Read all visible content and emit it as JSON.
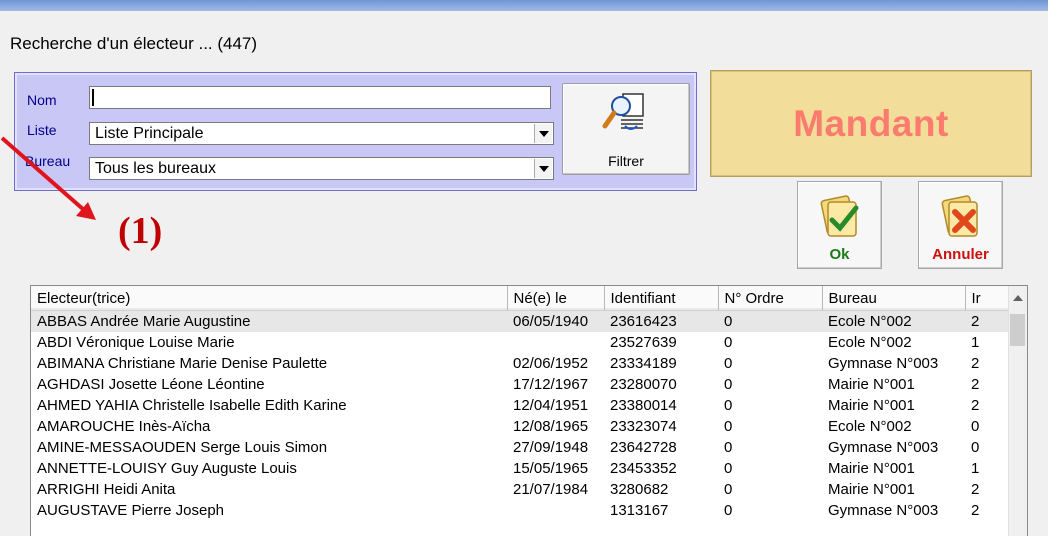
{
  "window": {
    "title": "Recherche d'un électeur ... (447)"
  },
  "filters": {
    "nom_label": "Nom",
    "nom_value": "",
    "liste_label": "Liste",
    "liste_value": "Liste Principale",
    "bureau_label": "Bureau",
    "bureau_value": "Tous les bureaux",
    "filter_button": "Filtrer"
  },
  "mandant_label": "Mandant",
  "actions": {
    "ok_label": "Ok",
    "cancel_label": "Annuler"
  },
  "annotation": "(1)",
  "colors": {
    "mandant_bg": "#f2de9a",
    "mandant_text": "#fb7b6e",
    "annotation": "#c00000",
    "panel_bg": "#c9c7f6"
  },
  "table": {
    "columns": [
      "Electeur(trice)",
      "Né(e) le",
      "Identifiant",
      "N° Ordre",
      "Bureau",
      "Ir"
    ],
    "rows": [
      [
        "ABBAS Andrée Marie Augustine",
        "06/05/1940",
        "23616423",
        "0",
        "Ecole N°002",
        "2"
      ],
      [
        "ABDI Véronique Louise Marie",
        "",
        "23527639",
        "0",
        "Ecole N°002",
        "1"
      ],
      [
        "ABIMANA Christiane Marie Denise Paulette",
        "02/06/1952",
        "23334189",
        "0",
        "Gymnase N°003",
        "2"
      ],
      [
        "AGHDASI Josette Léone Léontine",
        "17/12/1967",
        "23280070",
        "0",
        "Mairie N°001",
        "2"
      ],
      [
        "AHMED YAHIA Christelle Isabelle Edith Karine",
        "12/04/1951",
        "23380014",
        "0",
        "Mairie N°001",
        "2"
      ],
      [
        "AMAROUCHE Inès-Aïcha",
        "12/08/1965",
        "23323074",
        "0",
        "Ecole N°002",
        "0"
      ],
      [
        "AMINE-MESSAOUDEN Serge Louis Simon",
        "27/09/1948",
        "23642728",
        "0",
        "Gymnase N°003",
        "0"
      ],
      [
        "ANNETTE-LOUISY Guy Auguste Louis",
        "15/05/1965",
        "23453352",
        "0",
        "Mairie N°001",
        "1"
      ],
      [
        "ARRIGHI Heidi Anita",
        "21/07/1984",
        "3280682",
        "0",
        "Mairie N°001",
        "2"
      ],
      [
        "AUGUSTAVE Pierre Joseph",
        "",
        "1313167",
        "0",
        "Gymnase N°003",
        "2"
      ]
    ]
  }
}
